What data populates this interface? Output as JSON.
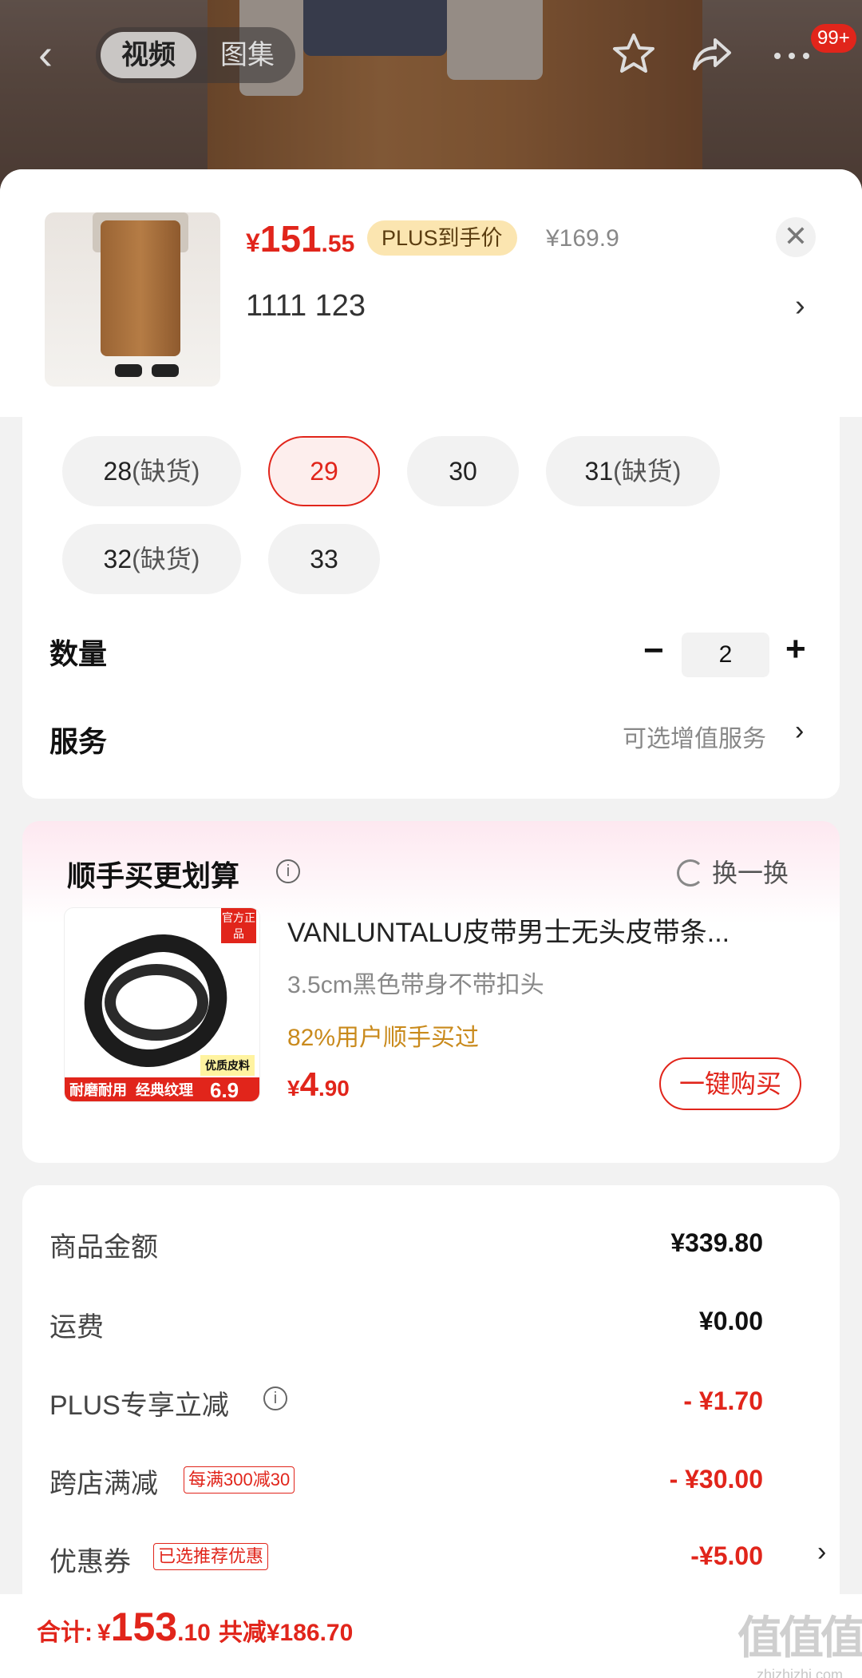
{
  "header": {
    "tab_video": "视频",
    "tab_gallery": "图集",
    "badge": "99+",
    "back_icon": "chevron-left-icon",
    "favorite_icon": "star-icon",
    "share_icon": "share-icon",
    "more_icon": "more-icon"
  },
  "product": {
    "price_symbol": "¥",
    "price_int": "151",
    "price_dec": ".55",
    "plus_tag": "PLUS到手价",
    "original_price": "¥169.9",
    "selected_spec": "1111  123",
    "close": "✕",
    "spec_arrow": "›"
  },
  "sizes": [
    {
      "label": "28",
      "note": "(缺货)"
    },
    {
      "label": "29",
      "note": ""
    },
    {
      "label": "30",
      "note": ""
    },
    {
      "label": "31",
      "note": "(缺货)"
    },
    {
      "label": "32",
      "note": "(缺货)"
    },
    {
      "label": "33",
      "note": ""
    }
  ],
  "selected_size": "29",
  "quantity": {
    "label": "数量",
    "value": "2",
    "minus": "−",
    "plus": "+"
  },
  "service": {
    "label": "服务",
    "hint": "可选增值服务",
    "arrow": "›"
  },
  "addon": {
    "title": "顺手买更划算",
    "swap": "换一换",
    "name": "VANLUNTALU皮带男士无头皮带条...",
    "spec": "3.5cm黑色带身不带扣头",
    "buyers": "82%用户顺手买过",
    "price_symbol": "¥",
    "price_int": "4",
    "price_dec": ".90",
    "buy_button": "一键购买",
    "image_text": {
      "tag": "官方正品",
      "strip_a": "耐磨耐用",
      "strip_b": "经典纹理",
      "quality": "优质皮料",
      "price": "6.9"
    }
  },
  "summary": {
    "goods_label": "商品金额",
    "goods_value": "¥339.80",
    "shipping_label": "运费",
    "shipping_value": "¥0.00",
    "plus_label": "PLUS专享立减",
    "plus_value": "- ¥1.70",
    "cross_label": "跨店满减",
    "cross_tag": "每满300减30",
    "cross_value": "- ¥30.00",
    "coupon_label": "优惠券",
    "coupon_tag": "已选推荐优惠",
    "coupon_value": "-¥5.00",
    "arrow": "›"
  },
  "footer": {
    "total_label": "合计:",
    "total_symbol": "¥",
    "total_int": "153",
    "total_dec": ".10",
    "saved": "共减¥186.70",
    "watermark_main": "值值值",
    "watermark_sub": "zhizhizhi.com"
  },
  "colors": {
    "accent": "#e1251b",
    "plus_tag_bg": "#fbe5b0",
    "buyers_text": "#c98a1c"
  }
}
